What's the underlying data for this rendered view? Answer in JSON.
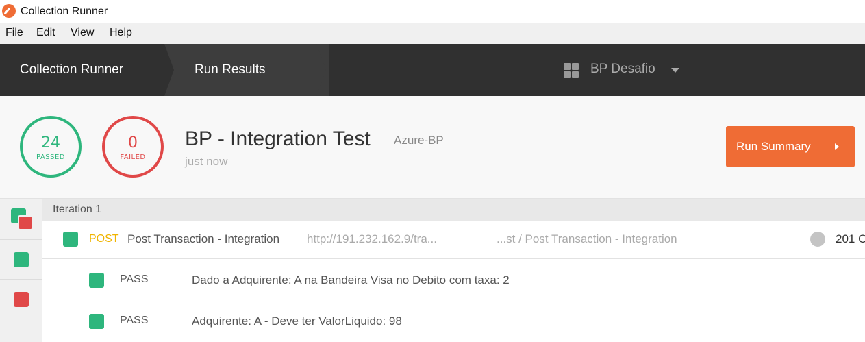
{
  "window": {
    "title": "Collection Runner"
  },
  "menu": [
    "File",
    "Edit",
    "View",
    "Help"
  ],
  "header": {
    "breadcrumb_1": "Collection Runner",
    "breadcrumb_2": "Run Results",
    "workspace": "BP Desafio"
  },
  "summary": {
    "passed_count": "24",
    "passed_label": "PASSED",
    "failed_count": "0",
    "failed_label": "FAILED",
    "collection_name": "BP - Integration Test",
    "environment": "Azure-BP",
    "time": "just now",
    "run_summary_label": "Run Summary"
  },
  "iteration": {
    "label": "Iteration 1",
    "request": {
      "method": "POST",
      "name": "Post Transaction - Integration",
      "url": "http://191.232.162.9/tra...",
      "path": "...st / Post Transaction - Integration",
      "status": "201 C"
    },
    "tests": [
      {
        "status": "PASS",
        "name": "Dado a Adquirente: A na Bandeira Visa no Debito com taxa: 2"
      },
      {
        "status": "PASS",
        "name": "Adquirente: A - Deve ter ValorLiquido: 98"
      }
    ]
  },
  "colors": {
    "pass": "#2eb67d",
    "fail": "#e04848",
    "accent": "#ef6c35",
    "header_bg": "#303030",
    "method_post": "#f0b400"
  },
  "icons": [
    "app-logo-icon",
    "workspace-grid-icon",
    "chevron-down-icon",
    "play-triangle-icon",
    "status-square-icon",
    "status-dot-icon"
  ]
}
